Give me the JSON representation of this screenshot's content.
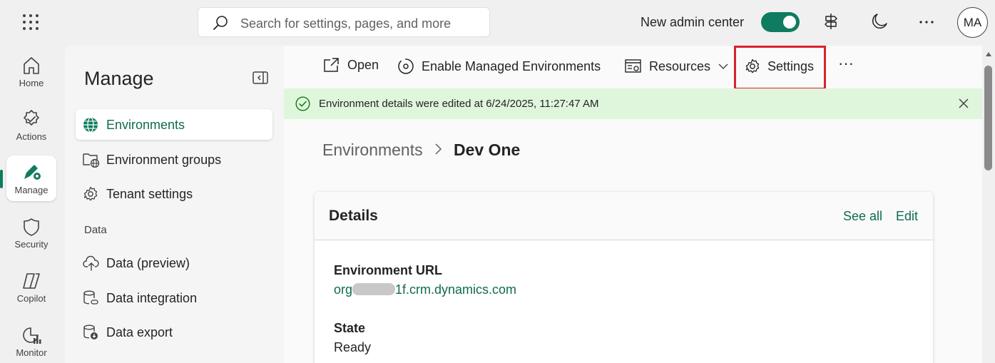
{
  "topbar": {
    "search_placeholder": "Search for settings, pages, and more",
    "admin_toggle_label": "New admin center",
    "avatar_initials": "MA",
    "toggle_on": true,
    "accent": "#0f7b5f"
  },
  "rail": {
    "items": [
      {
        "label": "Home",
        "icon": "home-icon"
      },
      {
        "label": "Actions",
        "icon": "actions-badge-icon"
      },
      {
        "label": "Manage",
        "icon": "manage-icon",
        "active": true
      },
      {
        "label": "Security",
        "icon": "shield-icon"
      },
      {
        "label": "Copilot",
        "icon": "copilot-icon"
      },
      {
        "label": "Monitor",
        "icon": "monitor-icon"
      }
    ]
  },
  "panel": {
    "title": "Manage",
    "items": [
      {
        "label": "Environments",
        "icon": "globe-icon",
        "selected": true
      },
      {
        "label": "Environment groups",
        "icon": "folder-globe-icon"
      },
      {
        "label": "Tenant settings",
        "icon": "gear-icon"
      }
    ],
    "data_section_label": "Data",
    "data_items": [
      {
        "label": "Data (preview)",
        "icon": "cloud-upload-icon"
      },
      {
        "label": "Data integration",
        "icon": "database-link-icon"
      },
      {
        "label": "Data export",
        "icon": "database-download-icon"
      }
    ]
  },
  "commandbar": {
    "open": "Open",
    "enable_managed": "Enable Managed Environments",
    "resources": "Resources",
    "settings": "Settings",
    "more": "···"
  },
  "banner": {
    "message": "Environment details were edited at 6/24/2025, 11:27:47 AM",
    "color": "#dff6dd"
  },
  "breadcrumb": {
    "root": "Environments",
    "current": "Dev One"
  },
  "details": {
    "title": "Details",
    "see_all": "See all",
    "edit": "Edit",
    "url_label": "Environment URL",
    "url_prefix": "org",
    "url_suffix": "1f.crm.dynamics.com",
    "state_label": "State",
    "state_value": "Ready"
  }
}
